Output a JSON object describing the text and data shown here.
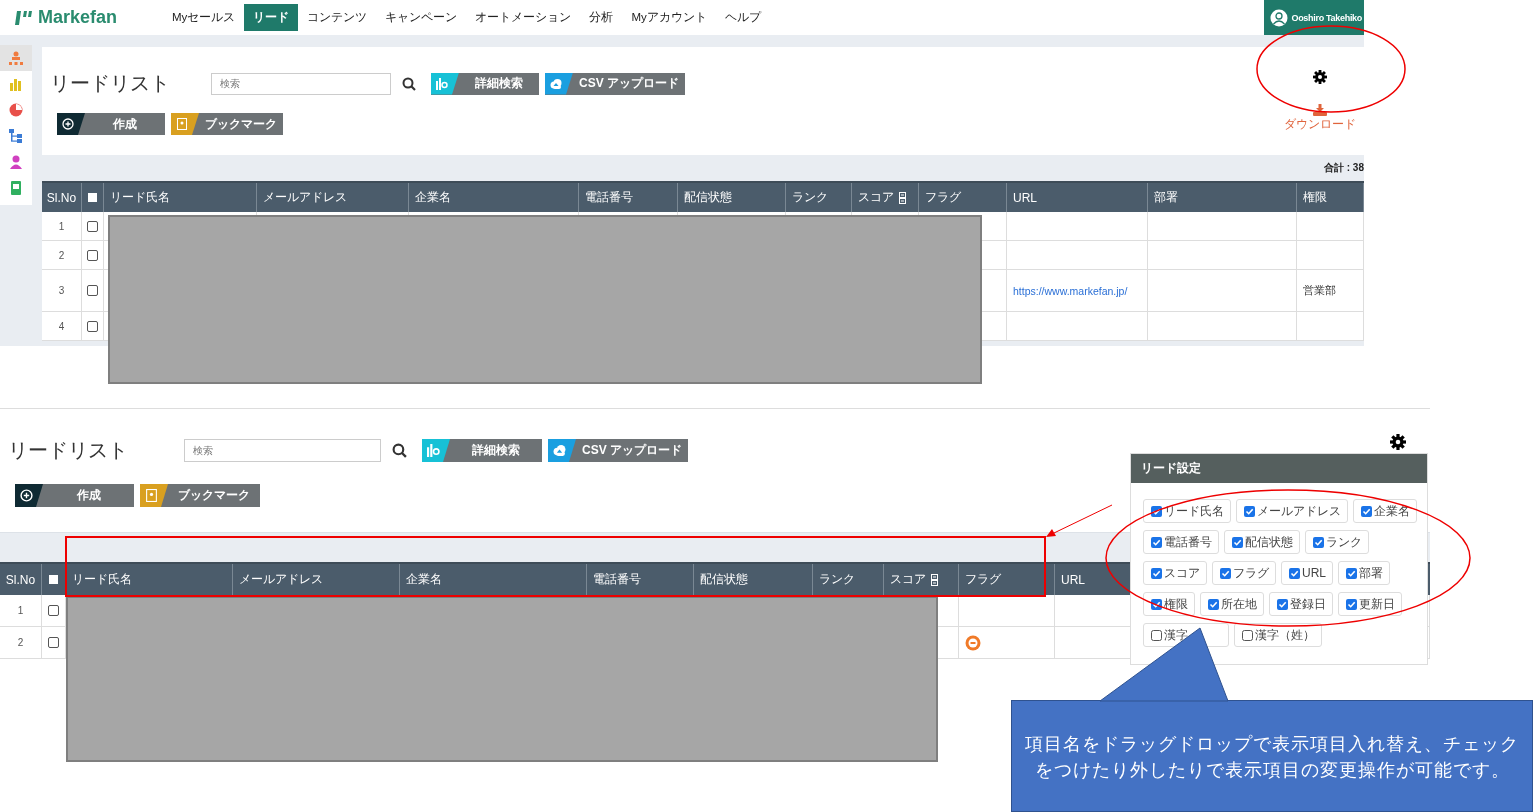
{
  "top_screen": {
    "nav": {
      "logo": "Markefan",
      "items": [
        {
          "label": "Myセールス",
          "selected": false
        },
        {
          "label": "リード",
          "selected": true
        },
        {
          "label": "コンテンツ",
          "selected": false
        },
        {
          "label": "キャンペーン",
          "selected": false
        },
        {
          "label": "オートメーション",
          "selected": false
        },
        {
          "label": "分析",
          "selected": false
        },
        {
          "label": "Myアカウント",
          "selected": false
        },
        {
          "label": "ヘルプ",
          "selected": false
        }
      ],
      "user": "Ooshiro Takehiko"
    },
    "sidebar": {
      "items": [
        {
          "kind": "org",
          "selected": true
        },
        {
          "kind": "chart",
          "selected": false
        },
        {
          "kind": "pie",
          "selected": false
        },
        {
          "kind": "tree",
          "selected": false
        },
        {
          "kind": "person",
          "selected": false
        },
        {
          "kind": "doc",
          "selected": false
        }
      ]
    },
    "page_title": "リードリスト",
    "search": {
      "placeholder": "検索"
    },
    "buttons": [
      {
        "kind": "search",
        "label": "詳細検索"
      },
      {
        "kind": "upload",
        "label": "CSV アップロード"
      },
      {
        "kind": "create",
        "label": "作成"
      },
      {
        "kind": "bookmark",
        "label": "ブックマーク"
      }
    ],
    "download": "ダウンロード",
    "total": "合計 : 38",
    "number_column": "Sl.No",
    "select_all_checked": false,
    "columns": [
      {
        "label": "リード氏名",
        "sortable": false
      },
      {
        "label": "メールアドレス",
        "sortable": false
      },
      {
        "label": "企業名",
        "sortable": false
      },
      {
        "label": "電話番号",
        "sortable": false
      },
      {
        "label": "配信状態",
        "sortable": false
      },
      {
        "label": "ランク",
        "sortable": false
      },
      {
        "label": "スコア",
        "sortable": true
      },
      {
        "label": "フラグ",
        "sortable": false
      },
      {
        "label": "URL",
        "sortable": false
      },
      {
        "label": "部署",
        "sortable": false
      },
      {
        "label": "権限",
        "sortable": false
      }
    ],
    "rows": [
      {
        "no": "1",
        "checked": false
      },
      {
        "no": "2",
        "checked": false
      },
      {
        "no": "3",
        "checked": false,
        "cells": [
          null,
          null,
          null,
          null,
          null,
          null,
          null,
          null,
          "https://www.markefan.jp/",
          null,
          "営業部"
        ]
      },
      {
        "no": "4",
        "checked": false
      }
    ]
  },
  "bottom_screen": {
    "page_title": "リードリスト",
    "search": {
      "placeholder": "検索"
    },
    "buttons": [
      {
        "kind": "search",
        "label": "詳細検索"
      },
      {
        "kind": "upload",
        "label": "CSV アップロード"
      },
      {
        "kind": "create",
        "label": "作成"
      },
      {
        "kind": "bookmark",
        "label": "ブックマーク"
      }
    ],
    "number_column": "Sl.No",
    "select_all_checked": false,
    "columns": [
      {
        "label": "リード氏名",
        "sortable": false
      },
      {
        "label": "メールアドレス",
        "sortable": false
      },
      {
        "label": "企業名",
        "sortable": false
      },
      {
        "label": "電話番号",
        "sortable": false
      },
      {
        "label": "配信状態",
        "sortable": false
      },
      {
        "label": "ランク",
        "sortable": false
      },
      {
        "label": "スコア",
        "sortable": true
      },
      {
        "label": "フラグ",
        "sortable": false
      },
      {
        "label": "URL",
        "sortable": false
      }
    ],
    "rows": [
      {
        "no": "1",
        "checked": false,
        "flagged": false
      },
      {
        "no": "2",
        "checked": false,
        "flagged": true
      }
    ],
    "settings_panel": {
      "title": "リード設定",
      "options": [
        {
          "label": "リード氏名",
          "checked": true
        },
        {
          "label": "メールアドレス",
          "checked": true
        },
        {
          "label": "企業名",
          "checked": true
        },
        {
          "label": "電話番号",
          "checked": true
        },
        {
          "label": "配信状態",
          "checked": true
        },
        {
          "label": "ランク",
          "checked": true
        },
        {
          "label": "スコア",
          "checked": true
        },
        {
          "label": "フラグ",
          "checked": true
        },
        {
          "label": "URL",
          "checked": true
        },
        {
          "label": "部署",
          "checked": true
        },
        {
          "label": "権限",
          "checked": true
        },
        {
          "label": "所在地",
          "checked": true
        },
        {
          "label": "登録日",
          "checked": true
        },
        {
          "label": "更新日",
          "checked": true
        },
        {
          "label": "漢字",
          "checked": false
        },
        {
          "label": "漢字（姓）",
          "checked": false
        }
      ]
    }
  },
  "callout": {
    "text": "項目名をドラッグドロップで表示項目入れ替え、チェックをつけたり外したりで表示項目の変更操作が可能です。"
  }
}
